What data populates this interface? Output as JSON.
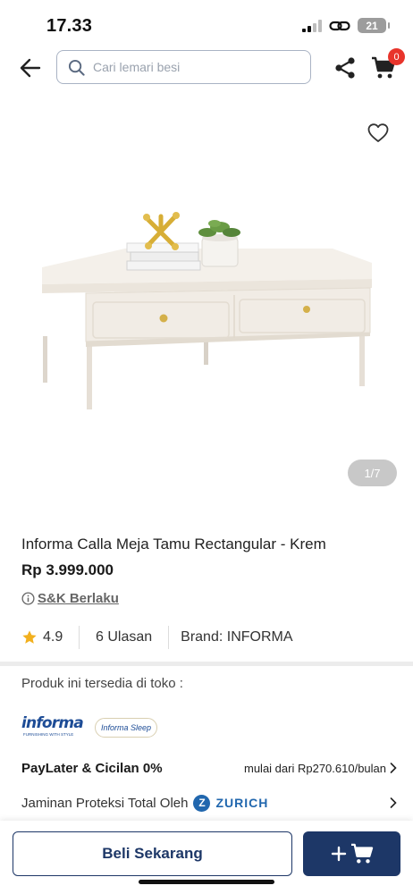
{
  "status_bar": {
    "time": "17.33",
    "battery": "21"
  },
  "header": {
    "search_placeholder": "Cari lemari besi",
    "cart_count": "0"
  },
  "gallery": {
    "counter": "1/7"
  },
  "product": {
    "title": "Informa Calla Meja Tamu Rectangular - Krem",
    "price": "Rp 3.999.000",
    "terms_link": "S&K Berlaku",
    "rating": "4.9",
    "reviews": "6 Ulasan",
    "brand": "Brand: INFORMA"
  },
  "availability": {
    "label": "Produk ini tersedia di toko :",
    "store_logos": [
      "informa",
      "Informa Sleep"
    ]
  },
  "paylater": {
    "title": "PayLater & Cicilan 0%",
    "detail": "mulai dari Rp270.610/bulan"
  },
  "insurance": {
    "label": "Jaminan Proteksi Total Oleh",
    "partner": "ZURICH"
  },
  "actions": {
    "buy_now": "Beli Sekarang"
  },
  "colors": {
    "primary": "#1d3767",
    "badge": "#e8342b",
    "zurich": "#2167ae"
  }
}
